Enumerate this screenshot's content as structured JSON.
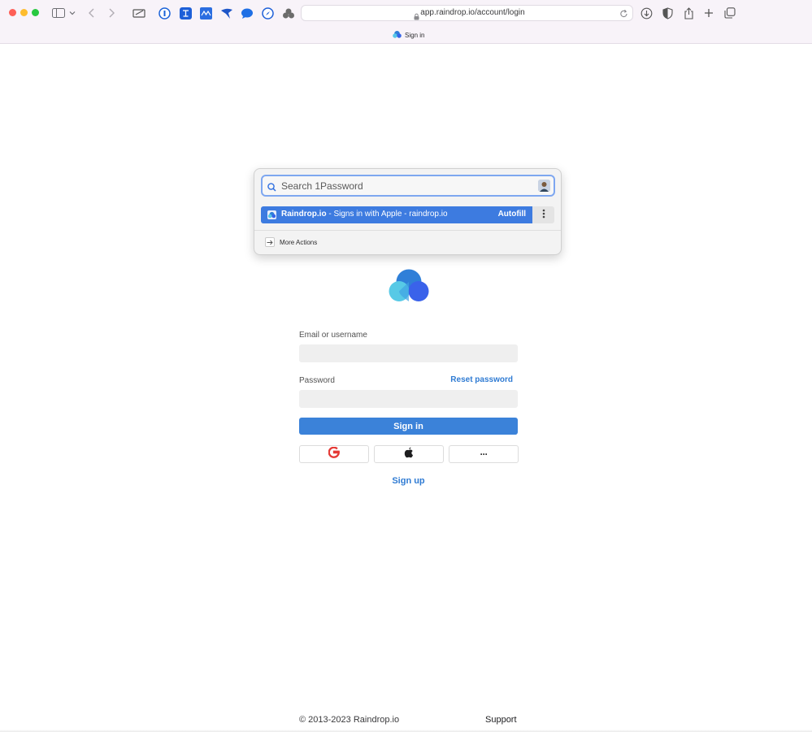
{
  "browser": {
    "url": "app.raindrop.io/account/login",
    "tab_title": "Sign in"
  },
  "onepassword": {
    "search_placeholder": "Search 1Password",
    "item_name": "Raindrop.io",
    "item_detail": " - Signs in with Apple - raindrop.io",
    "autofill_label": "Autofill",
    "more_actions_label": "More Actions"
  },
  "login": {
    "email_label": "Email or username",
    "email_value": "",
    "password_label": "Password",
    "password_value": "",
    "reset_password_label": "Reset password",
    "signin_label": "Sign in",
    "more_providers_label": "···",
    "signup_label": "Sign up"
  },
  "footer": {
    "copyright": "© 2013-2023 Raindrop.io",
    "support": "Support"
  },
  "colors": {
    "accent": "#3b82d9",
    "link": "#2f7bd3",
    "op_selection": "#3d7be0"
  }
}
